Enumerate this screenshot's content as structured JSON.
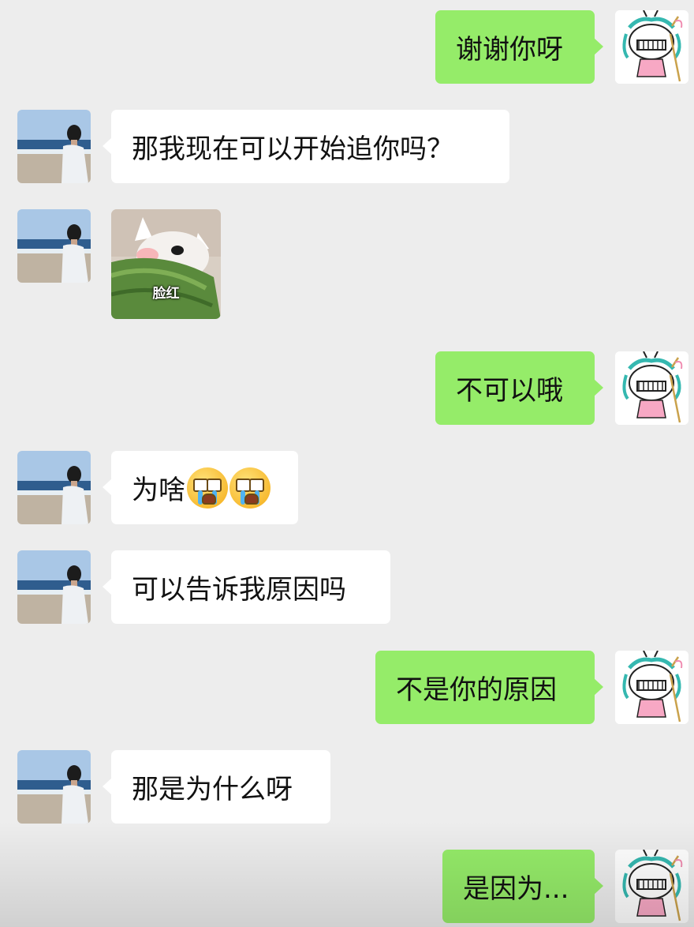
{
  "chat": {
    "messages": [
      {
        "from": "me",
        "text": "谢谢你呀"
      },
      {
        "from": "them",
        "text": "那我现在可以开始追你吗？"
      },
      {
        "from": "them",
        "sticker_caption": "脸红"
      },
      {
        "from": "me",
        "text": "不可以哦"
      },
      {
        "from": "them",
        "text": "为啥",
        "emojis": [
          "crying-emoji",
          "crying-emoji"
        ]
      },
      {
        "from": "them",
        "text": "可以告诉我原因吗"
      },
      {
        "from": "me",
        "text": "不是你的原因"
      },
      {
        "from": "them",
        "text": "那是为什么呀"
      },
      {
        "from": "me",
        "text": "是因为..."
      }
    ]
  },
  "colors": {
    "background": "#ededed",
    "outgoing_bubble": "#95ec69",
    "incoming_bubble": "#ffffff"
  }
}
